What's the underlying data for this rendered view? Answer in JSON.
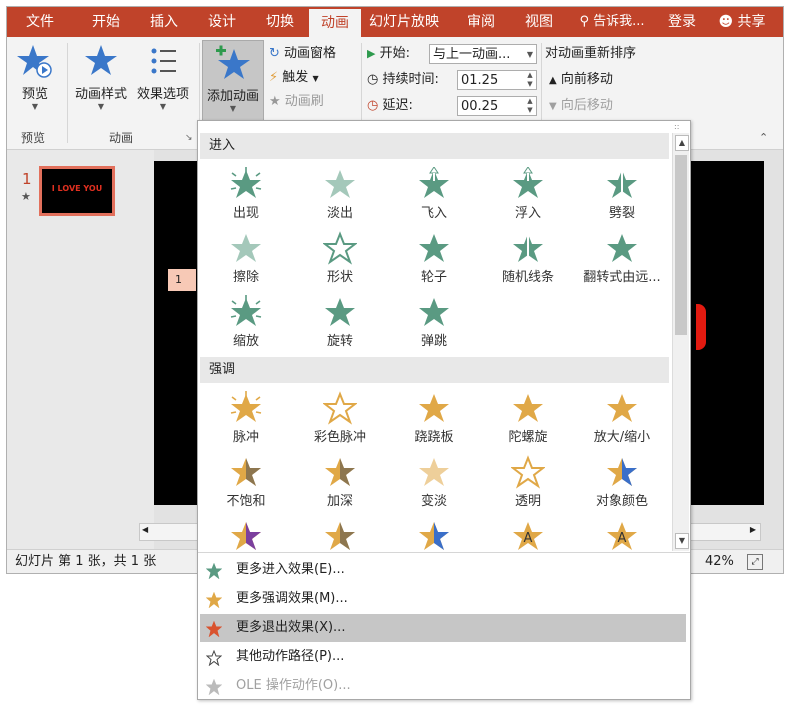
{
  "tabs": [
    "文件",
    "开始",
    "插入",
    "设计",
    "切换",
    "动画",
    "幻灯片放映",
    "审阅",
    "视图",
    "告诉我...",
    "登录",
    "共享"
  ],
  "active_tab": "动画",
  "ribbon": {
    "preview": {
      "label": "预览",
      "group": "预览"
    },
    "anim_style": {
      "label": "动画样式"
    },
    "effect_options": {
      "label": "效果选项"
    },
    "anim_group": "动画",
    "add_anim": {
      "label": "添加动画"
    },
    "anim_pane": "动画窗格",
    "trigger": "触发",
    "anim_brush": "动画刷",
    "start": {
      "label": "开始:",
      "value": "与上一动画..."
    },
    "duration": {
      "label": "持续时间:",
      "value": "01.25"
    },
    "delay": {
      "label": "延迟:",
      "value": "00.25"
    },
    "reorder": {
      "title": "对动画重新排序",
      "forward": "向前移动",
      "backward": "向后移动"
    }
  },
  "slide_panel": {
    "number": "1",
    "thumb_text": "I LOVE YOU"
  },
  "slide_tag": "1",
  "status": {
    "left": "幻灯片 第 1 张，共 1 张",
    "zoom": "42%"
  },
  "dropdown": {
    "entrance": {
      "title": "进入",
      "items": [
        "出现",
        "淡出",
        "飞入",
        "浮入",
        "劈裂",
        "擦除",
        "形状",
        "轮子",
        "随机线条",
        "翻转式由远...",
        "缩放",
        "旋转",
        "弹跳"
      ]
    },
    "emphasis": {
      "title": "强调",
      "items": [
        "脉冲",
        "彩色脉冲",
        "跷跷板",
        "陀螺旋",
        "放大/缩小",
        "不饱和",
        "加深",
        "变淡",
        "透明",
        "对象颜色",
        "",
        "",
        "",
        "",
        ""
      ]
    },
    "menu": [
      "更多进入效果(E)...",
      "更多强调效果(M)...",
      "更多退出效果(X)...",
      "其他动作路径(P)...",
      "OLE 操作动作(O)..."
    ]
  },
  "colors": {
    "accent": "#c0432a",
    "entrance_star": "#5a9a82",
    "emphasis_star": "#e0a847",
    "exit_star": "#d9532f"
  }
}
